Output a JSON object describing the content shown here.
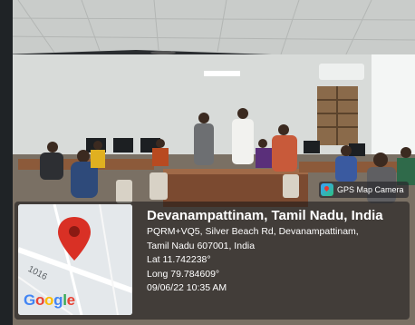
{
  "badge": {
    "label": "GPS Map Camera",
    "icon": "gps-map-camera-icon"
  },
  "location": {
    "title": "Devanampattinam, Tamil Nadu, India",
    "address_line1": "PQRM+VQ5, Silver Beach Rd, Devanampattinam,",
    "address_line2": "Tamil Nadu 607001, India",
    "lat": "Lat 11.742238°",
    "long": "Long 79.784609°",
    "datetime": "09/06/22 10:35 AM"
  },
  "map": {
    "road_number": "1016",
    "logo_letters": [
      "G",
      "o",
      "o",
      "g",
      "l",
      "e"
    ],
    "pin_color": "#d93025"
  }
}
